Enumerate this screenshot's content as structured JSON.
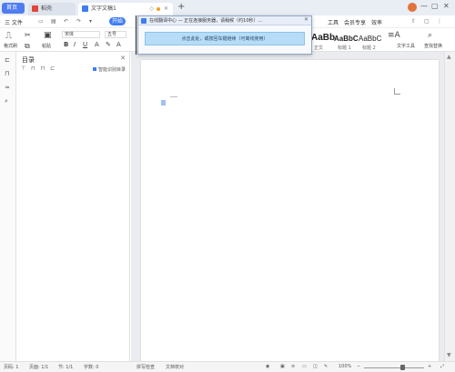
{
  "titlebar": {
    "home_tab": "首页",
    "tabs": [
      {
        "label": "稻壳"
      },
      {
        "label": "文字文稿1"
      }
    ],
    "new_tab": "+",
    "window": {
      "minimize": "—",
      "maximize": "▢",
      "close": "✕"
    }
  },
  "menubar": {
    "file": "三 文件",
    "items": [
      "开始",
      "插入",
      "页面",
      "引用",
      "审阅",
      "视图",
      "工具",
      "会员专享",
      "效率"
    ],
    "active": "开始"
  },
  "ribbon": {
    "format_painter": "格式刷",
    "paste": "粘贴",
    "font_name": "宋体",
    "font_size": "五号",
    "styles": [
      {
        "sample": "AaBb",
        "label": "正文"
      },
      {
        "sample": "AaBbC",
        "label": "标题 1"
      },
      {
        "sample": "AaBbC",
        "label": "标题 2"
      },
      {
        "sample": "AaBbC",
        "label": "标题 3"
      }
    ],
    "text_tools": "文字工具",
    "find_replace": "查找替换"
  },
  "navpane": {
    "title": "目录",
    "smart_label": "智能识别目录"
  },
  "popup": {
    "title": "在线翻译中心 — 正在连接服务器，请稍候（约10秒）…",
    "button_label": "点击此处，或按回车键继续（可离线使用）"
  },
  "statusbar": {
    "page": "页码: 1",
    "pages": "页面: 1/1",
    "section": "节: 1/1",
    "words": "字数: 0",
    "spell": "拼写检查",
    "doc_check": "文档校对",
    "zoom": "100%"
  },
  "colors": {
    "accent": "#3f7df2",
    "home_tab": "#4f7cf1",
    "doc_bg": "#ebecef",
    "popup_button": "#b7dcf7"
  }
}
